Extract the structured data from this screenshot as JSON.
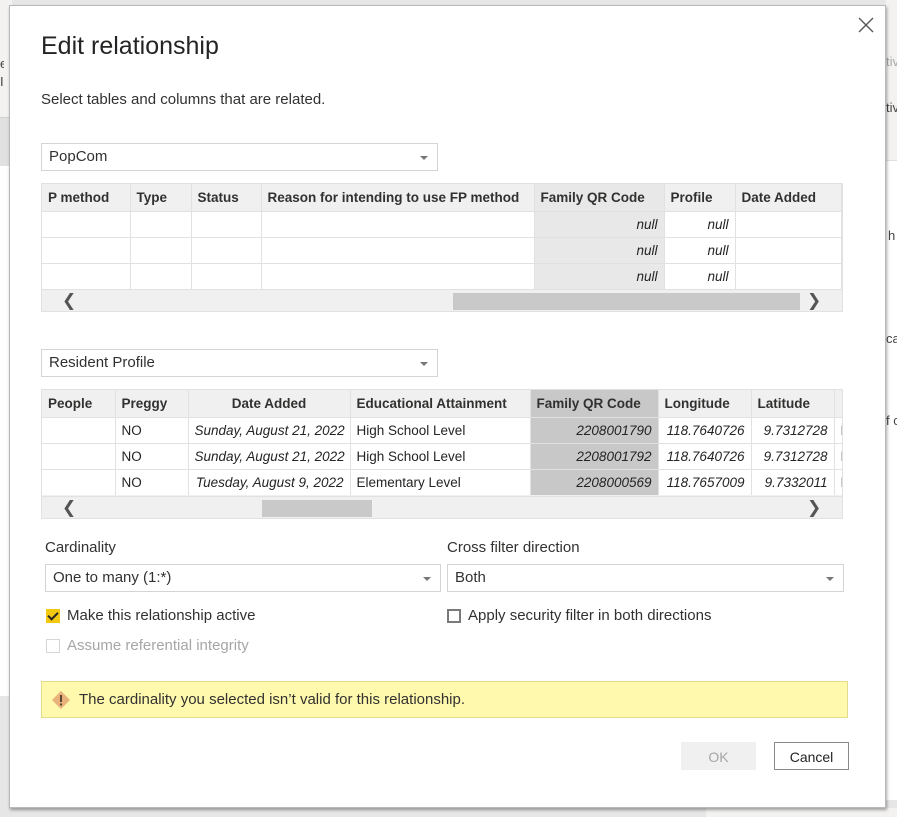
{
  "background": {
    "left_fragments": [
      "e",
      "I"
    ],
    "right_fragments": [
      "tiv",
      "tiv",
      "h",
      "ca",
      "f c"
    ]
  },
  "dialog": {
    "title": "Edit relationship",
    "subtitle": "Select tables and columns that are related.",
    "close_icon": "close-icon"
  },
  "table1": {
    "selected_table": "PopCom",
    "columns": [
      "P method",
      "Type",
      "Status",
      "Reason for intending to use FP method",
      "Family QR Code",
      "Profile",
      "Date Added"
    ],
    "selected_column": "Family QR Code",
    "rows": [
      [
        "",
        "",
        "",
        "",
        "null",
        "null",
        ""
      ],
      [
        "",
        "",
        "",
        "",
        "null",
        "null",
        ""
      ],
      [
        "",
        "",
        "",
        "",
        "null",
        "null",
        ""
      ]
    ],
    "scroll_position": 0.62
  },
  "table2": {
    "selected_table": "Resident Profile",
    "columns": [
      "People",
      "Preggy",
      "Date Added",
      "Educational Attainment",
      "Family QR Code",
      "Longitude",
      "Latitude",
      ""
    ],
    "selected_column": "Family QR Code",
    "rows": [
      [
        "",
        "NO",
        "Sunday, August 21, 2022",
        "High School Level",
        "2208001790",
        "118.7640726",
        "9.7312728",
        "I"
      ],
      [
        "",
        "NO",
        "Sunday, August 21, 2022",
        "High School Level",
        "2208001792",
        "118.7640726",
        "9.7312728",
        "I"
      ],
      [
        "",
        "NO",
        "Tuesday, August 9, 2022",
        "Elementary Level",
        "2208000569",
        "118.7657009",
        "9.7332011",
        "I"
      ]
    ],
    "scroll_position": 0.18
  },
  "cardinality": {
    "label": "Cardinality",
    "value": "One to many (1:*)"
  },
  "cross_filter": {
    "label": "Cross filter direction",
    "value": "Both"
  },
  "options": {
    "make_active": {
      "label": "Make this relationship active",
      "checked": true
    },
    "referential_integrity": {
      "label": "Assume referential integrity",
      "checked": false,
      "disabled": true
    },
    "security_filter": {
      "label": "Apply security filter in both directions",
      "checked": false
    }
  },
  "warning": {
    "icon": "warning-icon",
    "message": "The cardinality you selected isn’t valid for this relationship."
  },
  "buttons": {
    "ok": "OK",
    "cancel": "Cancel"
  },
  "colors": {
    "accent_checkbox": "#f2c811",
    "warning_bg": "#fff9ae",
    "warning_icon": "#e8b27a"
  }
}
